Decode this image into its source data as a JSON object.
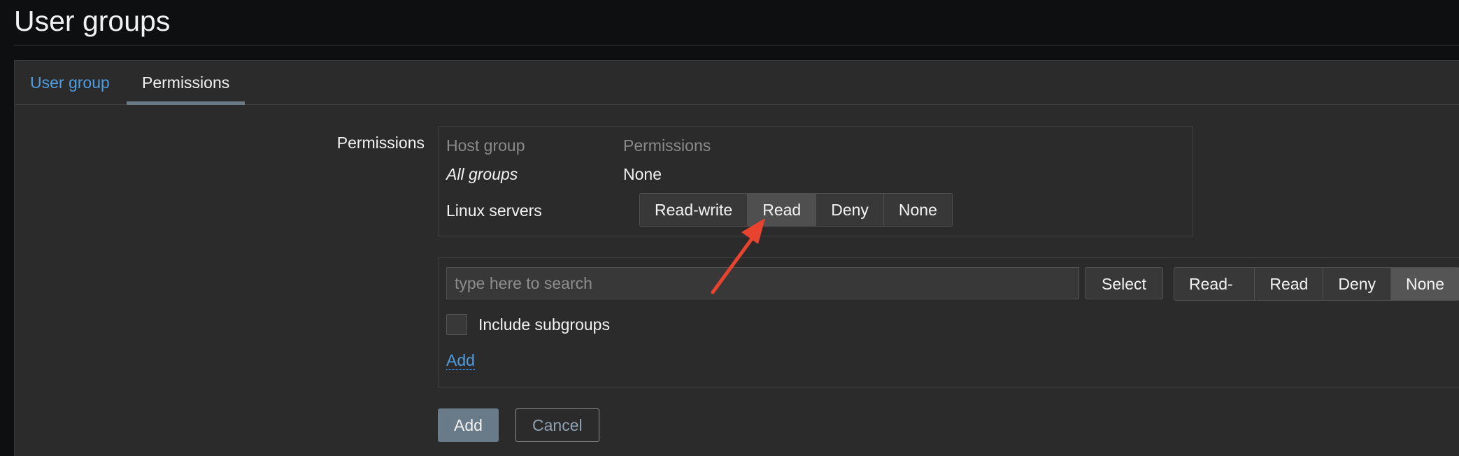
{
  "header": {
    "title": "User groups"
  },
  "tabs": [
    {
      "label": "User group",
      "active": false
    },
    {
      "label": "Permissions",
      "active": true
    }
  ],
  "form": {
    "permissions_label": "Permissions",
    "table": {
      "headers": [
        "Host group",
        "Permissions"
      ],
      "rows": [
        {
          "group": "All groups",
          "permission": "None"
        },
        {
          "group": "Linux servers",
          "options": [
            "Read-write",
            "Read",
            "Deny",
            "None"
          ],
          "selected": "Read"
        }
      ]
    },
    "add_permission": {
      "search_placeholder": "type here to search",
      "select_label": "Select",
      "options": [
        "Read-write",
        "Read",
        "Deny",
        "None"
      ],
      "selected": "None",
      "include_subgroups_label": "Include subgroups",
      "include_subgroups_checked": false,
      "add_link": "Add"
    },
    "buttons": {
      "add": "Add",
      "cancel": "Cancel"
    }
  },
  "colors": {
    "accent_link": "#4f9de0",
    "primary_button": "#697a88",
    "annotation_arrow": "#e8432f"
  }
}
